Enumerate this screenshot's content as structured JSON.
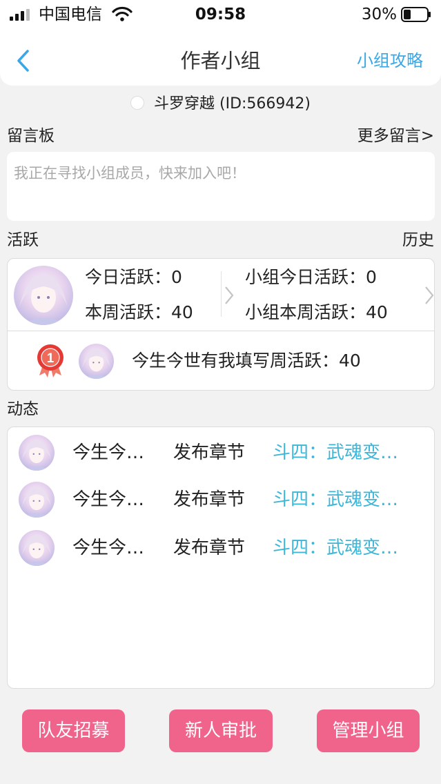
{
  "status_bar": {
    "carrier": "中国电信",
    "time": "09:58",
    "battery": "30%",
    "icons": [
      "signal-icon",
      "wifi-icon",
      "battery-icon"
    ]
  },
  "nav": {
    "title": "作者小组",
    "right_link": "小组攻略",
    "back_icon": "chevron-left-icon"
  },
  "group": {
    "name": "斗罗穿越 (ID:566942)"
  },
  "message_board": {
    "label": "留言板",
    "more": "更多留言>",
    "placeholder": "我正在寻找小组成员，快来加入吧！"
  },
  "activity": {
    "label": "活跃",
    "history": "历史",
    "today_label": "今日活跃：",
    "today_value": "0",
    "week_label": "本周活跃：",
    "week_value": "40",
    "group_today_label": "小组今日活跃：",
    "group_today_value": "0",
    "group_week_label": "小组本周活跃：",
    "group_week_value": "40",
    "top_member": {
      "rank": "1",
      "text": "今生今世有我填写周活跃：",
      "value": "40"
    }
  },
  "feed": {
    "label": "动态",
    "items": [
      {
        "user": "今生今…",
        "action": "发布章节",
        "target": "斗四：武魂变…"
      },
      {
        "user": "今生今…",
        "action": "发布章节",
        "target": "斗四：武魂变…"
      },
      {
        "user": "今生今…",
        "action": "发布章节",
        "target": "斗四：武魂变…"
      }
    ]
  },
  "buttons": {
    "recruit": "队友招募",
    "approve": "新人审批",
    "manage": "管理小组"
  },
  "colors": {
    "accent_blue": "#3aa7e6",
    "feed_link": "#3cb6d8",
    "button_pink": "#f0648c",
    "medal_red": "#e53935"
  }
}
